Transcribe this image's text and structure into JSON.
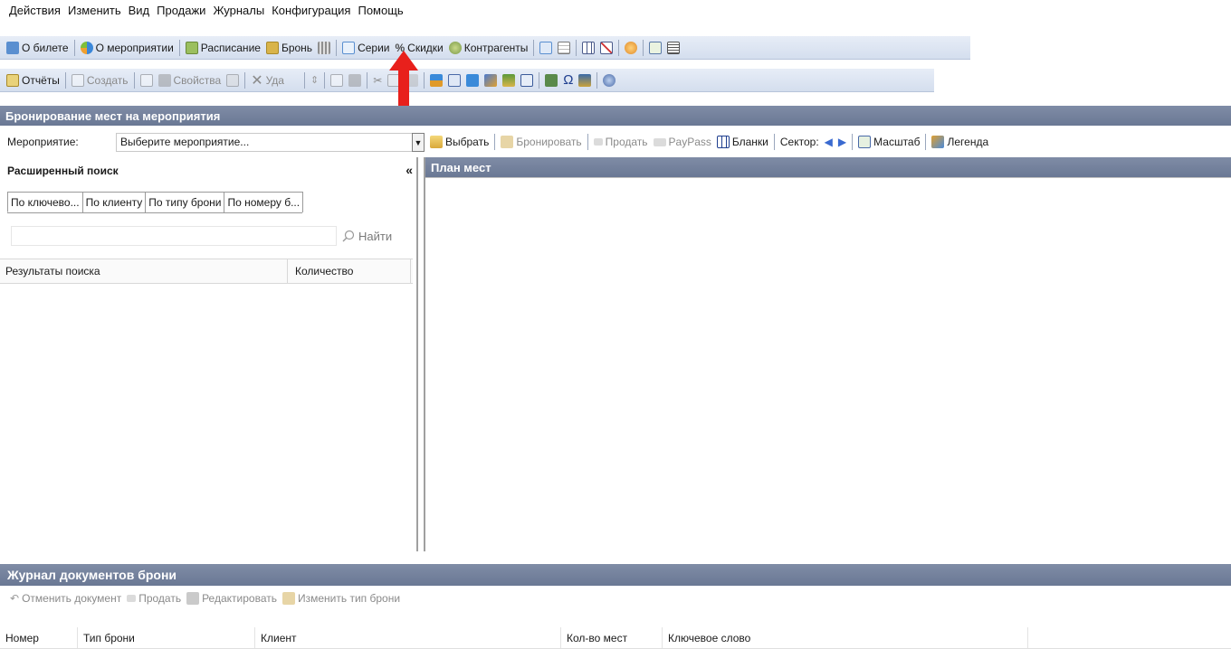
{
  "menu": [
    "Действия",
    "Изменить",
    "Вид",
    "Продажи",
    "Журналы",
    "Конфигурация",
    "Помощь"
  ],
  "toolbar1": [
    {
      "label": "О билете",
      "icon": "ticket-icon",
      "color": "#5a8fd0"
    },
    {
      "label": "О мероприятии",
      "icon": "event-info-icon",
      "color": "#3a87d9"
    },
    {
      "label": "Расписание",
      "icon": "schedule-icon",
      "color": "#7fa84a"
    },
    {
      "label": "Бронь",
      "icon": "booking-icon",
      "color": "#c9a23a"
    },
    {
      "label": "",
      "icon": "seats-icon",
      "color": "#8f8f8f"
    },
    {
      "label": "Серии",
      "icon": "series-icon",
      "color": "#5a8fd0"
    },
    {
      "label": "Скидки",
      "icon": "percent-icon",
      "color": "#6a6a6a"
    },
    {
      "label": "Контрагенты",
      "icon": "contractors-icon",
      "color": "#7a9a4a"
    }
  ],
  "toolbar1_extra_icons": [
    "report-form-icon",
    "document-icon",
    "grid-icon",
    "table-x-icon",
    "smile-icon",
    "checkbox-icon",
    "layout-icon"
  ],
  "toolbar2": [
    {
      "label": "Отчёты",
      "icon": "reports-icon",
      "disabled": false
    },
    {
      "label": "Создать",
      "icon": "create-icon",
      "disabled": true
    },
    {
      "label": "Свойства",
      "icon": "properties-icon",
      "disabled": true
    },
    {
      "label": "Уда",
      "icon": "delete-icon",
      "disabled": true
    }
  ],
  "toolbar2_extra_icons": [
    "refresh-icon",
    "preview-icon",
    "print-icon",
    "cut-icon",
    "copy-icon",
    "paste-icon",
    "cashier-icon",
    "card-icon",
    "network-icon",
    "tools-icon",
    "export-icon",
    "calculator-icon",
    "calendar-icon",
    "omega-icon",
    "archive-icon",
    "settings-icon"
  ],
  "section_title": "Бронирование мест на мероприятия",
  "event": {
    "label": "Мероприятие:",
    "value": "Выберите мероприятие...",
    "tools": [
      {
        "label": "Выбрать",
        "icon": "folder-open-icon",
        "disabled": false
      },
      {
        "label": "Бронировать",
        "icon": "booking-icon",
        "disabled": true
      },
      {
        "label": "Продать",
        "icon": "sell-icon",
        "disabled": true
      },
      {
        "label": "PayPass",
        "icon": "paypass-icon",
        "disabled": true
      },
      {
        "label": "Бланки",
        "icon": "blanks-icon",
        "disabled": false
      }
    ],
    "sector_label": "Сектор:",
    "scale_label": "Масштаб",
    "legend_label": "Легенда"
  },
  "search_panel": {
    "title": "Расширенный поиск",
    "collapse": "«",
    "tabs": [
      "По ключево...",
      "По клиенту",
      "По типу брони",
      "По номеру б..."
    ],
    "query": "",
    "find_label": "Найти",
    "columns": [
      "Результаты поиска",
      "Количество"
    ]
  },
  "plan_title": "План мест",
  "journal": {
    "title": "Журнал документов брони",
    "actions": [
      {
        "label": "Отменить документ",
        "icon": "undo-icon"
      },
      {
        "label": "Продать",
        "icon": "sell-icon"
      },
      {
        "label": "Редактировать",
        "icon": "edit-icon"
      },
      {
        "label": "Изменить тип брони",
        "icon": "change-type-icon"
      }
    ],
    "columns": [
      "Номер",
      "Тип брони",
      "Клиент",
      "Кол-во мест",
      "Ключевое слово"
    ]
  },
  "colors": {
    "accent_arrow": "#e8201c",
    "section_bar": "#6f7d99"
  }
}
